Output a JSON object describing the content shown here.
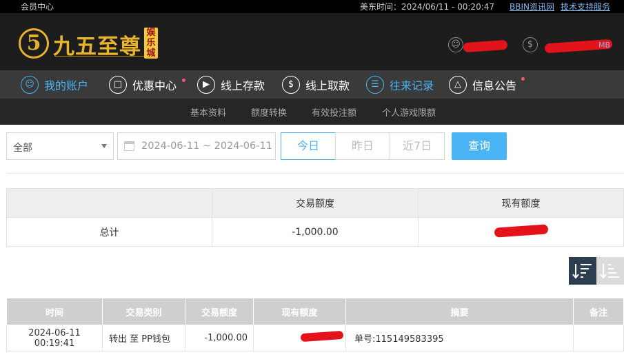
{
  "topbar": {
    "member_center": "会员中心",
    "time_label": "美东时间：2024/06/11 - 00:20:47",
    "link_bbin": "BBIN资讯网",
    "link_support": "技术支持服务"
  },
  "brand": {
    "logo_mark": "5",
    "name": "九五至尊",
    "tag": "娱乐城",
    "gold": "#e9b42f"
  },
  "header": {
    "user_icon": "user-icon",
    "balance_icon": "dollar-icon",
    "balance_suffix": "MB"
  },
  "nav": {
    "items": [
      {
        "label": "我的账户",
        "icon": "user-icon",
        "active": true
      },
      {
        "label": "优惠中心",
        "icon": "gift-icon",
        "dot": true
      },
      {
        "label": "线上存款",
        "icon": "deposit-icon"
      },
      {
        "label": "线上取款",
        "icon": "withdraw-icon"
      },
      {
        "label": "往来记录",
        "icon": "records-icon",
        "active": true
      },
      {
        "label": "信息公告",
        "icon": "bell-icon",
        "dot": true
      }
    ],
    "active_color": "#4ab3f4"
  },
  "subnav": {
    "items": [
      "基本资料",
      "额度转换",
      "有效投注额",
      "个人游戏限额"
    ]
  },
  "filters": {
    "type_select": "全部",
    "date_range": "2024-06-11 ~ 2024-06-11",
    "today": "今日",
    "yesterday": "昨日",
    "last7": "近7日",
    "query": "查询"
  },
  "summary": {
    "col_trade": "交易额度",
    "col_balance": "现有额度",
    "row_label": "总计",
    "trade_value": "-1,000.00"
  },
  "details": {
    "headers": [
      "时间",
      "交易类别",
      "交易额度",
      "现有额度",
      "摘要",
      "备注"
    ],
    "rows": [
      {
        "time": "2024-06-11 00:19:41",
        "type": "转出 至 PP钱包",
        "amount": "-1,000.00",
        "summary": "单号:115149583395",
        "remark": ""
      }
    ]
  }
}
